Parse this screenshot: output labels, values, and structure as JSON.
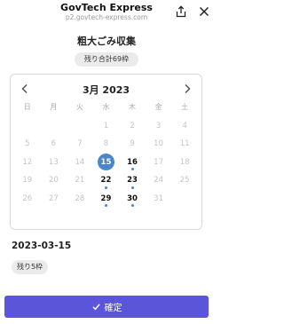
{
  "header": {
    "title": "GovTech Express",
    "url": "p2.govtech-express.com",
    "share_icon": "share-icon",
    "close_icon": "close-icon"
  },
  "main": {
    "title": "粗大ごみ収集",
    "remaining_total": "残り合計69枠"
  },
  "calendar": {
    "month_label": "3月 2023",
    "weekdays": [
      "日",
      "月",
      "火",
      "水",
      "木",
      "金",
      "土"
    ],
    "weeks": [
      [
        {
          "day": "",
          "available": false
        },
        {
          "day": "",
          "available": false
        },
        {
          "day": "",
          "available": false
        },
        {
          "day": "1",
          "available": false
        },
        {
          "day": "2",
          "available": false
        },
        {
          "day": "3",
          "available": false
        },
        {
          "day": "4",
          "available": false
        }
      ],
      [
        {
          "day": "5",
          "available": false
        },
        {
          "day": "6",
          "available": false
        },
        {
          "day": "7",
          "available": false
        },
        {
          "day": "8",
          "available": false
        },
        {
          "day": "9",
          "available": false
        },
        {
          "day": "10",
          "available": false
        },
        {
          "day": "11",
          "available": false
        }
      ],
      [
        {
          "day": "12",
          "available": false
        },
        {
          "day": "13",
          "available": false
        },
        {
          "day": "14",
          "available": false
        },
        {
          "day": "15",
          "available": true,
          "selected": true
        },
        {
          "day": "16",
          "available": true
        },
        {
          "day": "17",
          "available": false
        },
        {
          "day": "18",
          "available": false
        }
      ],
      [
        {
          "day": "19",
          "available": false
        },
        {
          "day": "20",
          "available": false
        },
        {
          "day": "21",
          "available": false
        },
        {
          "day": "22",
          "available": true
        },
        {
          "day": "23",
          "available": true
        },
        {
          "day": "24",
          "available": false
        },
        {
          "day": "25",
          "available": false
        }
      ],
      [
        {
          "day": "26",
          "available": false
        },
        {
          "day": "27",
          "available": false
        },
        {
          "day": "28",
          "available": false
        },
        {
          "day": "29",
          "available": true
        },
        {
          "day": "30",
          "available": true
        },
        {
          "day": "31",
          "available": false
        },
        {
          "day": "",
          "available": false
        }
      ]
    ],
    "colors": {
      "selected": "#4a86c8",
      "dot": "#4a86c8",
      "disabled_text": "#c4c4c4"
    }
  },
  "selection": {
    "date": "2023-03-15",
    "remaining": "残り5枠"
  },
  "confirm": {
    "label": "確定",
    "color": "#5a55d9"
  }
}
